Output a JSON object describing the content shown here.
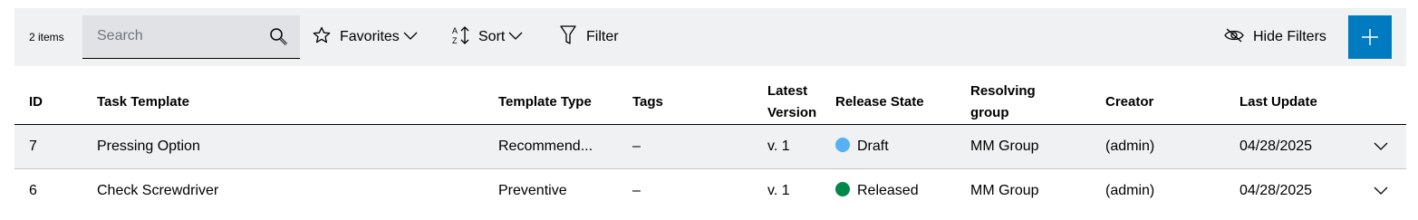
{
  "toolbar": {
    "item_count": "2 items",
    "search_placeholder": "Search",
    "favorites_label": "Favorites",
    "sort_label": "Sort",
    "filter_label": "Filter",
    "hide_filters_label": "Hide Filters",
    "accent_color": "#007bc0"
  },
  "table": {
    "headers": {
      "id": "ID",
      "task_template": "Task Template",
      "template_type": "Template Type",
      "tags": "Tags",
      "latest_version_line1": "Latest",
      "latest_version_line2": "Version",
      "release_state": "Release State",
      "resolving_group_line1": "Resolving",
      "resolving_group_line2": "group",
      "creator": "Creator",
      "last_update": "Last Update"
    },
    "rows": [
      {
        "id": "7",
        "task_template": "Pressing Option",
        "template_type": "Recommend...",
        "tags": "–",
        "latest_version": "v. 1",
        "release_state": "Draft",
        "release_state_color": "#56b0f2",
        "resolving_group": "MM Group",
        "creator": "(admin)",
        "last_update": "04/28/2025"
      },
      {
        "id": "6",
        "task_template": "Check Screwdriver",
        "template_type": "Preventive",
        "tags": "–",
        "latest_version": "v. 1",
        "release_state": "Released",
        "release_state_color": "#00884a",
        "resolving_group": "MM Group",
        "creator": "(admin)",
        "last_update": "04/28/2025"
      }
    ]
  }
}
